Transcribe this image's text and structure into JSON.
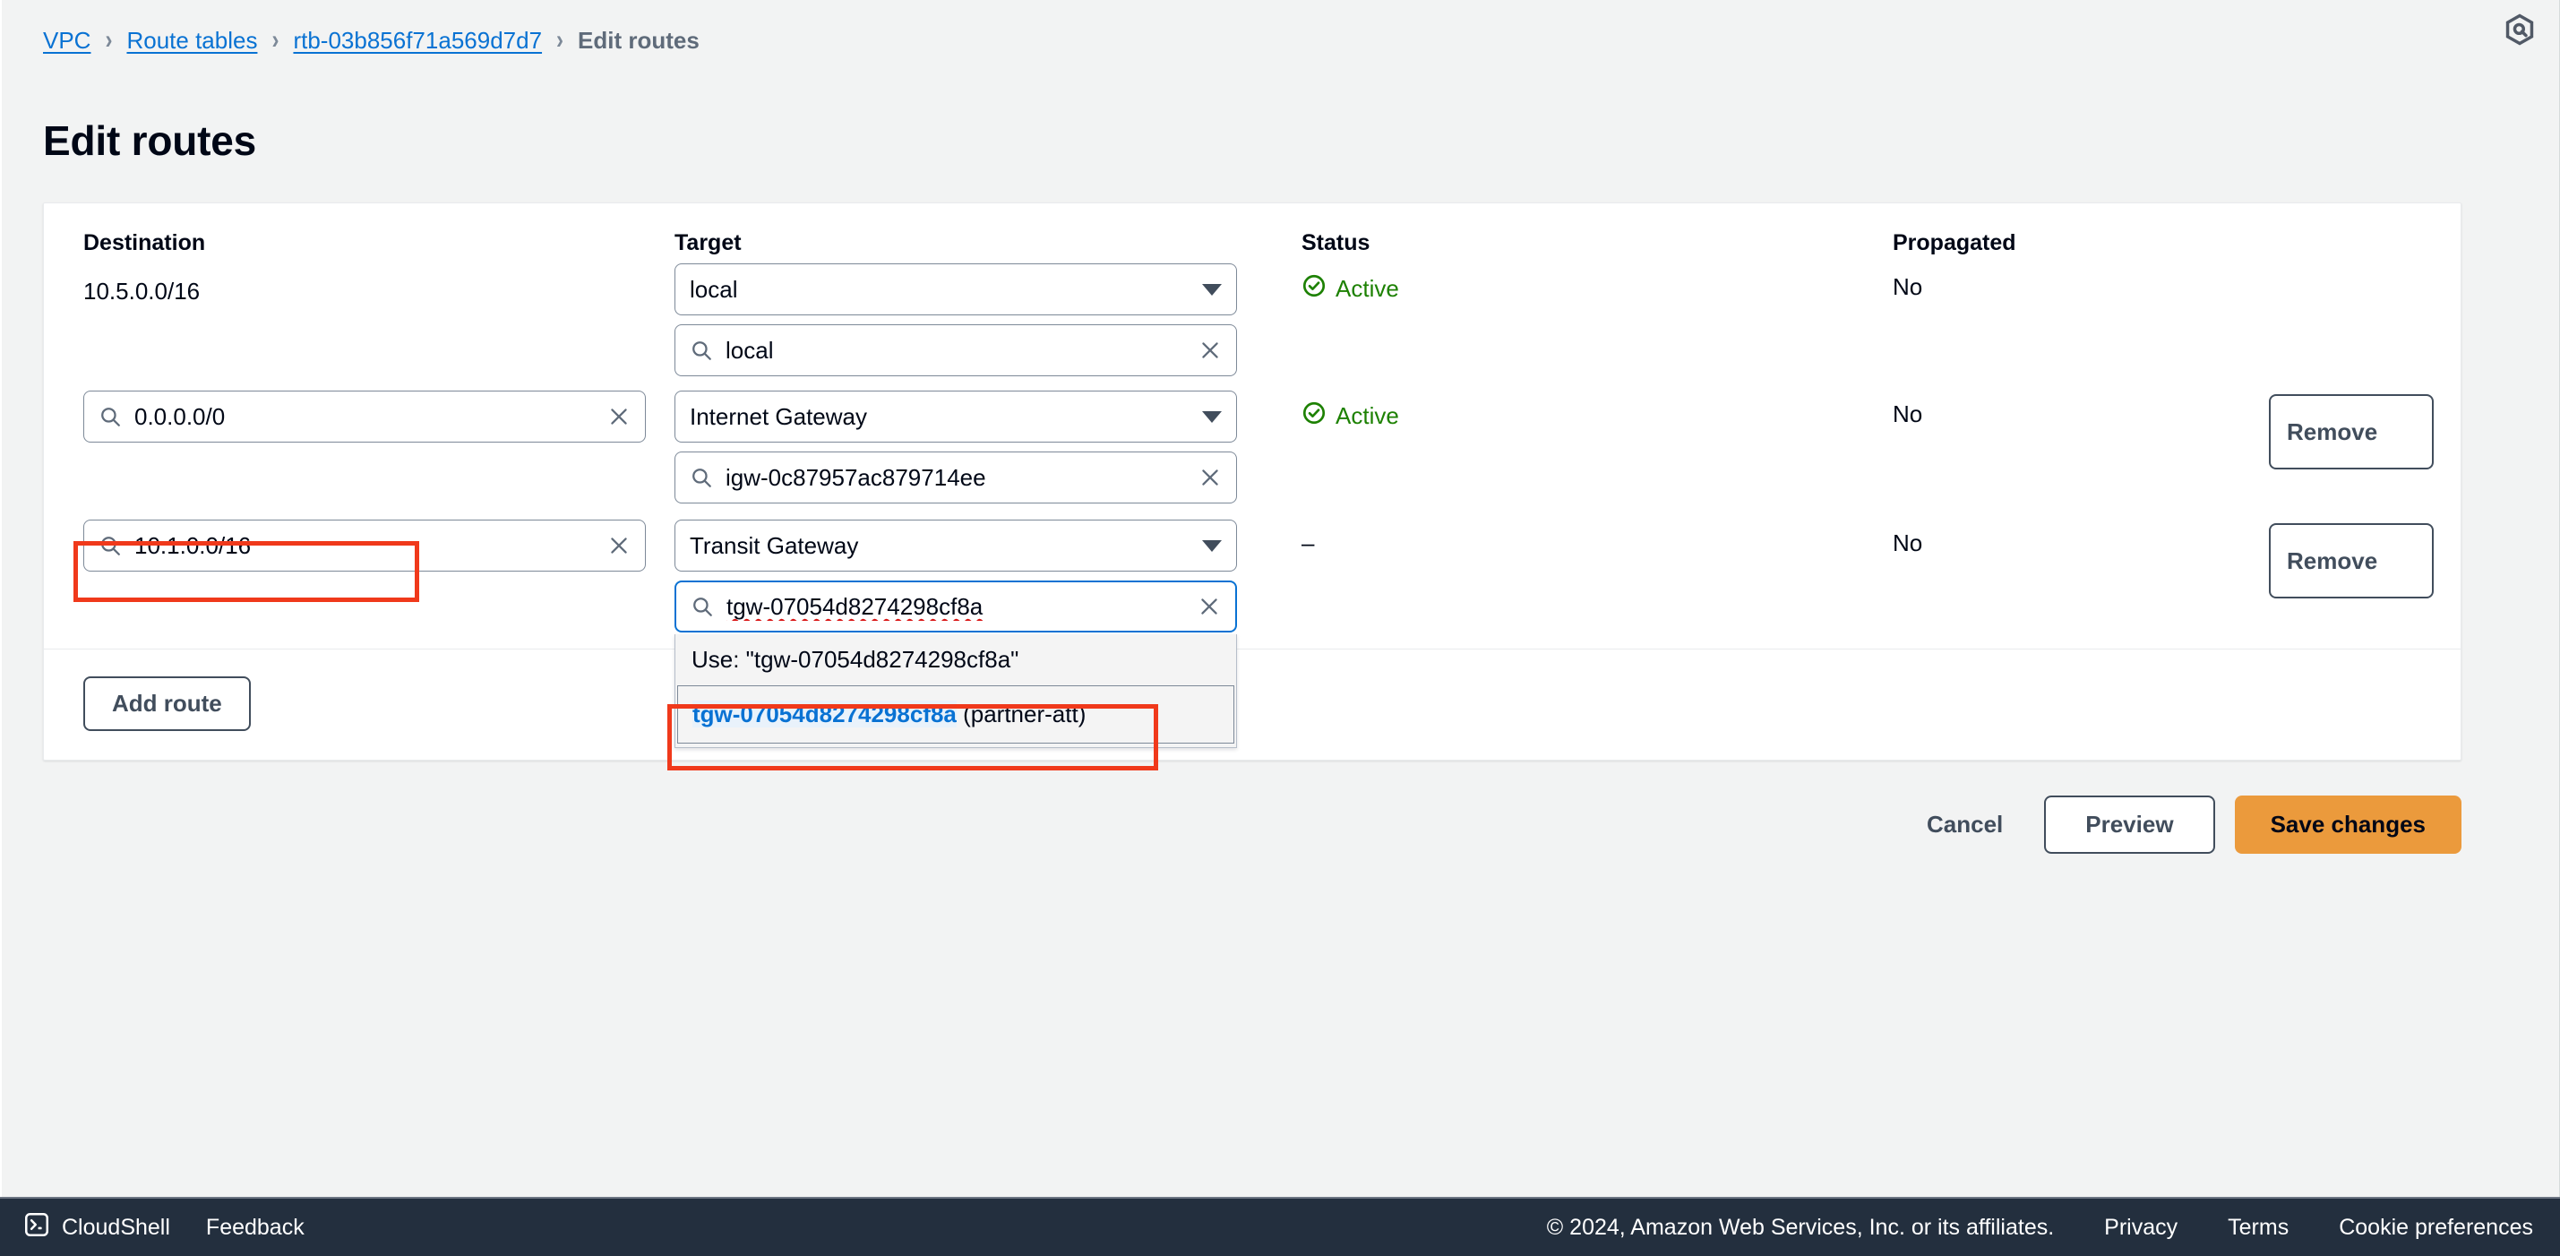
{
  "breadcrumb": {
    "items": [
      {
        "label": "VPC",
        "link": true
      },
      {
        "label": "Route tables",
        "link": true
      },
      {
        "label": "rtb-03b856f71a569d7d7",
        "link": true
      },
      {
        "label": "Edit routes",
        "link": false
      }
    ],
    "separator": "›"
  },
  "page": {
    "title": "Edit routes"
  },
  "table": {
    "headers": {
      "destination": "Destination",
      "target": "Target",
      "status": "Status",
      "propagated": "Propagated"
    },
    "rows": [
      {
        "destination_value": "10.5.0.0/16",
        "destination_editable": false,
        "target_select": "local",
        "target_search": "local",
        "status": "Active",
        "status_icon": "check-circle-icon",
        "propagated": "No",
        "remove_label": null
      },
      {
        "destination_value": "0.0.0.0/0",
        "destination_editable": true,
        "target_select": "Internet Gateway",
        "target_search": "igw-0c87957ac879714ee",
        "status": "Active",
        "status_icon": "check-circle-icon",
        "propagated": "No",
        "remove_label": "Remove"
      },
      {
        "destination_value": "10.1.0.0/16",
        "destination_editable": true,
        "target_select": "Transit Gateway",
        "target_search": "tgw-07054d8274298cf8a",
        "status": "–",
        "status_icon": null,
        "propagated": "No",
        "remove_label": "Remove"
      }
    ]
  },
  "dropdown": {
    "use_option": "Use: \"tgw-07054d8274298cf8a\"",
    "option_match": "tgw-07054d8274298cf8a",
    "option_rest": " (partner-att)"
  },
  "buttons": {
    "add_route": "Add route",
    "cancel": "Cancel",
    "preview": "Preview",
    "save": "Save changes"
  },
  "footer": {
    "cloudshell": "CloudShell",
    "feedback": "Feedback",
    "copyright": "© 2024, Amazon Web Services, Inc. or its affiliates.",
    "privacy": "Privacy",
    "terms": "Terms",
    "cookie_preferences": "Cookie preferences"
  },
  "colors": {
    "accent_link": "#0972d3",
    "status_active": "#1d8102",
    "save_button": "#eb9a3c",
    "annotation": "#f0391b",
    "footer_bg": "#232f3e",
    "page_bg": "#f2f3f3"
  },
  "icons": {
    "search": "search-icon",
    "clear": "close-icon",
    "caret": "chevron-down-icon",
    "status": "check-circle-icon",
    "assistant": "q-assistant-icon",
    "cloudshell": "cloudshell-icon"
  }
}
